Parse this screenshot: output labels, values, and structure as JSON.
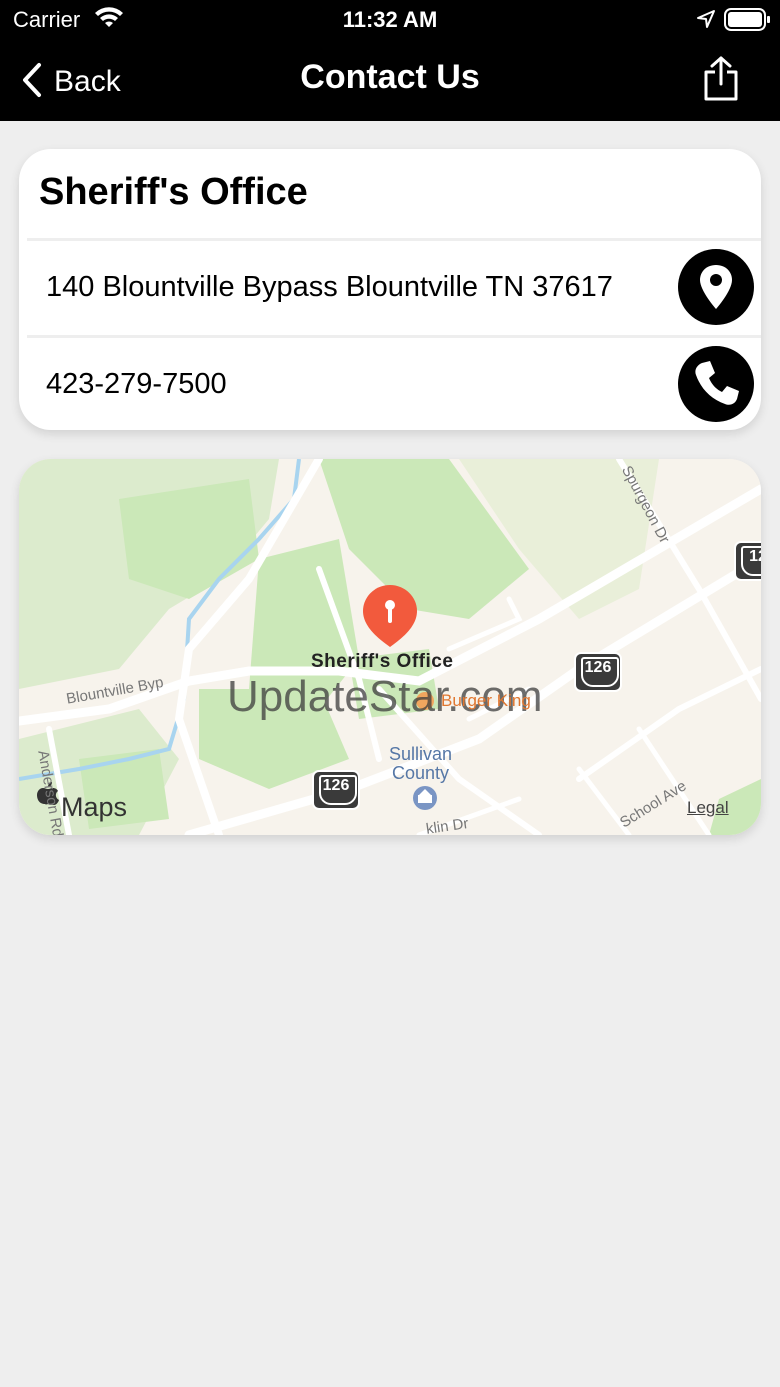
{
  "status_bar": {
    "carrier": "Carrier",
    "time": "11:32 AM"
  },
  "nav": {
    "back_label": "Back",
    "title": "Contact Us"
  },
  "contact": {
    "office_name": "Sheriff's Office",
    "address": "140 Blountville Bypass Blountville TN 37617",
    "phone": "423-279-7500"
  },
  "map": {
    "pin_label": "Sheriff's Office",
    "watermark": "UpdateStar.com",
    "poi_burger_king": "Burger King",
    "poi_county_line1": "Sullivan",
    "poi_county_line2": "County",
    "road_blountville": "Blountville Byp",
    "road_anderson": "Anderson Rd",
    "road_spurgeon": "Spurgeon Dr",
    "road_school": "School Ave",
    "road_franklin": "klin Dr",
    "route_number": "126",
    "route_number_edge": "12",
    "attribution": "Maps",
    "legal": "Legal"
  },
  "colors": {
    "bar_background": "#000000",
    "page_background": "#eeeeee",
    "card_background": "#ffffff",
    "pin_color": "#f25a3d",
    "park_green": "#cbe8b8",
    "water_blue": "#a8d4ef"
  },
  "icons": {
    "wifi": "wifi-icon",
    "location_arrow": "location-arrow-icon",
    "battery": "battery-icon",
    "back": "chevron-left-icon",
    "share": "share-icon",
    "map_pin": "map-pin-icon",
    "phone": "phone-icon"
  }
}
